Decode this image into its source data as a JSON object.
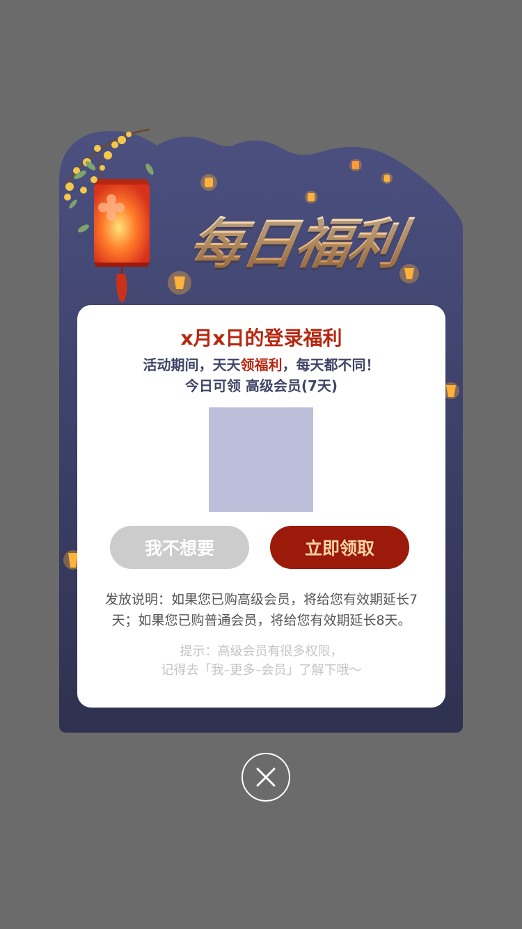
{
  "header": {
    "title_art": "每日福利"
  },
  "panel": {
    "title": "x月x日的登录福利",
    "subtitle_part1": "活动期间，天天",
    "subtitle_highlight": "领福利",
    "subtitle_part2": "，每天都不同！",
    "reward_line": "今日可领 高级会员(7天)",
    "decline_label": "我不想要",
    "claim_label": "立即领取",
    "description": "发放说明：如果您已购高级会员，将给您有效期延长7天；如果您已购普通会员，将给您有效期延长8天。",
    "tip_line1": "提示：高级会员有很多权限，",
    "tip_line2": "记得去「我–更多–会员」了解下哦～"
  },
  "icons": {
    "close": "close-icon",
    "hanging_lantern": "hanging-lantern-icon",
    "sky_lantern": "sky-lantern-icon",
    "flower_branch": "osmanthus-branch-icon"
  },
  "colors": {
    "overlay": "#6b6b6b",
    "card_top": "#4b5080",
    "card_bottom": "#2f3150",
    "accent_red": "#b7260f",
    "claim_button": "#9b1a0a",
    "claim_text": "#f7d2a2",
    "decline_button": "#cccccc",
    "title_gold": "#f3c58a"
  }
}
